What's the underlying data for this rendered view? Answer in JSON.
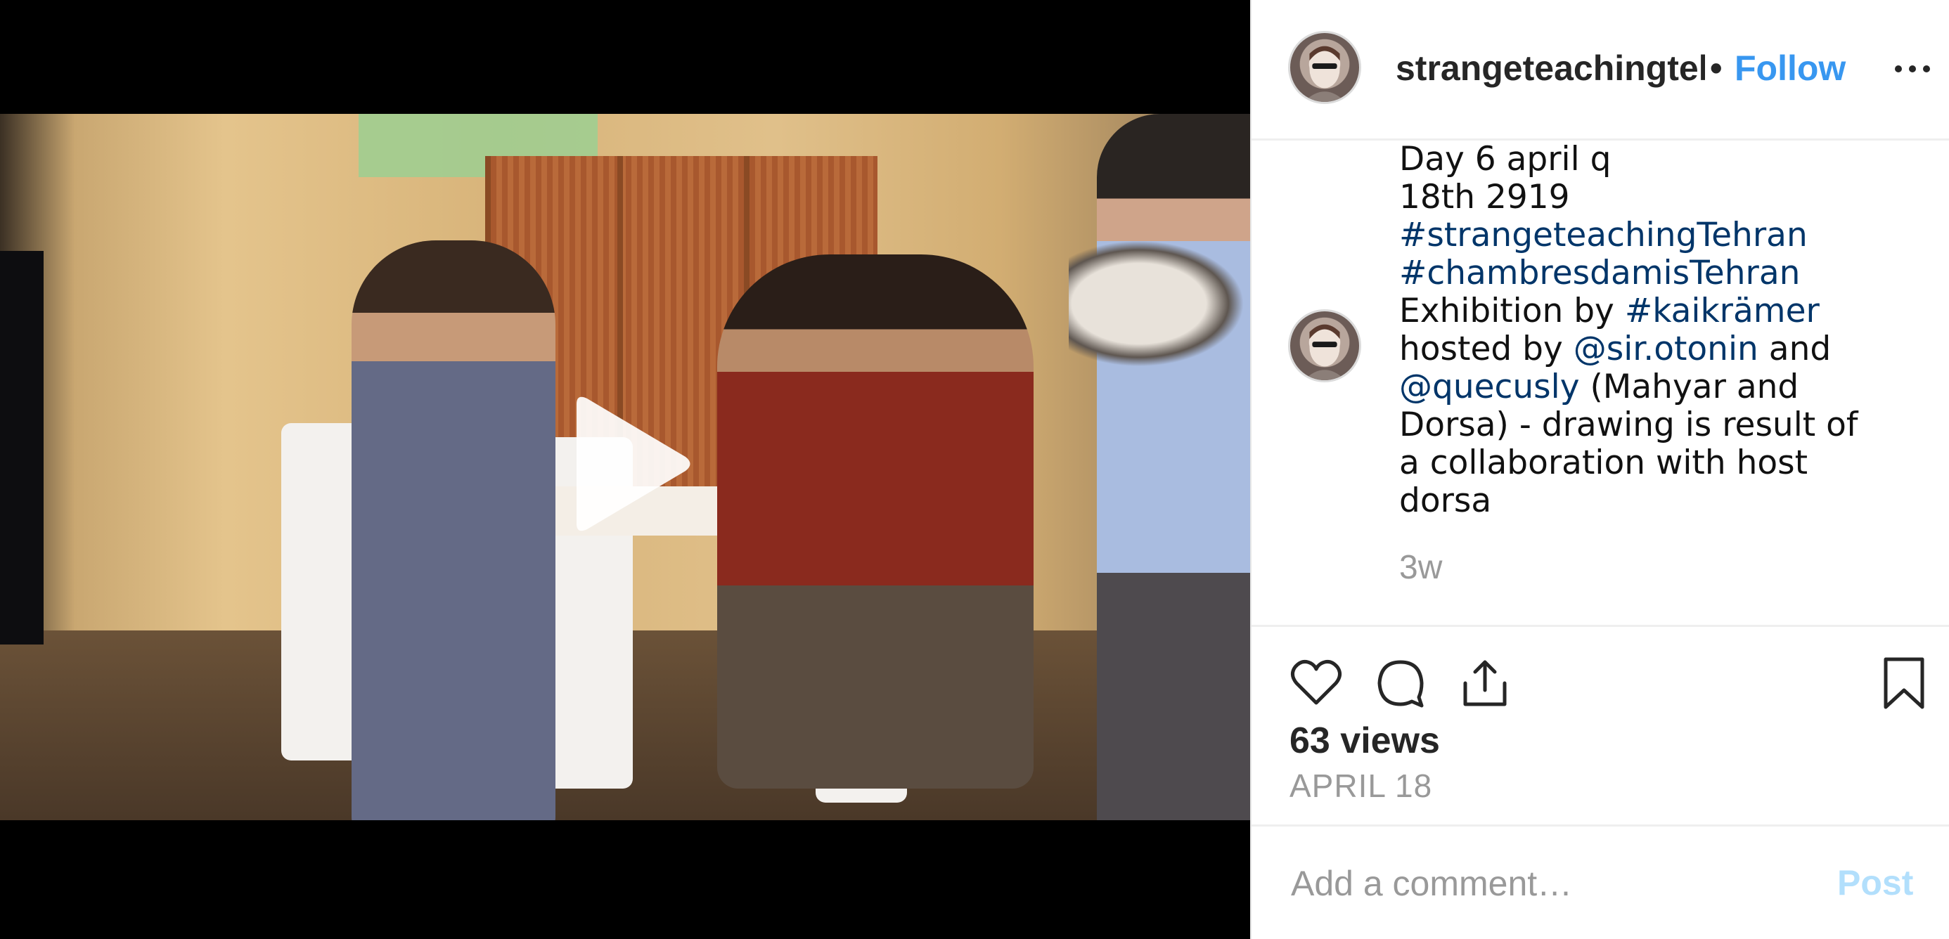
{
  "post": {
    "username": "strangeteachingtehran",
    "separator": "•",
    "follow_label": "Follow",
    "more_icon": "more-horizontal-icon"
  },
  "caption": {
    "lines": [
      {
        "text": "Day 6 april q"
      },
      {
        "text": "18th 2919"
      },
      {
        "hashtag": "#strangeteachingTehran"
      },
      {
        "hashtag": "#chambresdamisTehran"
      },
      {
        "prefix": "Exhibition by ",
        "link": "#kaikrämer"
      },
      {
        "prefix": "hosted by ",
        "link": "@sir.otonin",
        "suffix": " and"
      },
      {
        "link": "@quecusly",
        "suffix": " (Mahyar and"
      },
      {
        "text": "Dorsa) - drawing is result of"
      },
      {
        "text": "a collaboration with host"
      },
      {
        "text": "dorsa"
      }
    ],
    "time_ago": "3w"
  },
  "actions": {
    "icons": [
      "heart-icon",
      "comment-icon",
      "share-icon",
      "bookmark-icon"
    ],
    "views": "63 views",
    "date": "APRIL 18"
  },
  "comment": {
    "placeholder": "Add a comment…",
    "post_label": "Post"
  },
  "media": {
    "play_icon": "play-icon"
  },
  "colors": {
    "link": "#003569",
    "follow": "#3897f0",
    "post_disabled": "#b2dffc",
    "muted": "#999999"
  }
}
